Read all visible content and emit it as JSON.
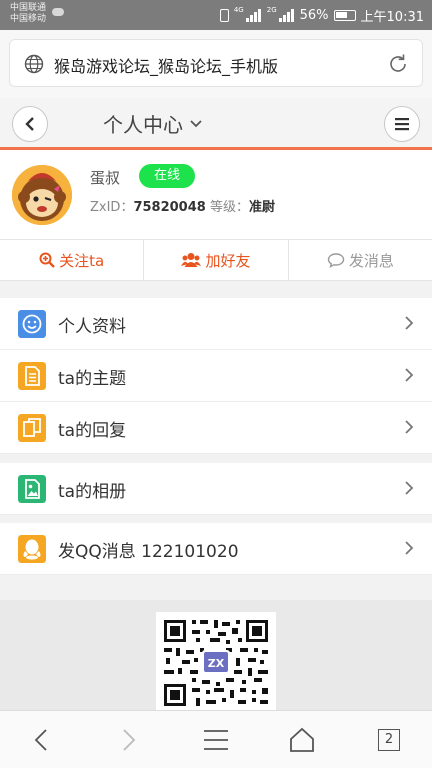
{
  "statusbar": {
    "carrier1": "中国联通",
    "carrier2": "中国移动",
    "network1": "4G",
    "network2": "2G",
    "battery": "56%",
    "time": "上午10:31"
  },
  "browser": {
    "url_title": "猴岛游戏论坛_猴岛论坛_手机版",
    "tab_count": "2"
  },
  "header": {
    "title": "个人中心"
  },
  "profile": {
    "username": "蛋叔",
    "status": "在线",
    "id_label": "ZxID：",
    "id_value": "75820048",
    "level_label": "等级：",
    "level_value": "准尉"
  },
  "actions": [
    {
      "label": "关注ta",
      "icon": "search-plus-icon"
    },
    {
      "label": "加好友",
      "icon": "users-icon"
    },
    {
      "label": "发消息",
      "icon": "comment-icon"
    }
  ],
  "menu": [
    {
      "label": "个人资料",
      "icon": "smile-icon",
      "color": "#4a8ee6"
    },
    {
      "label": "ta的主题",
      "icon": "document-icon",
      "color": "#f5a623"
    },
    {
      "label": "ta的回复",
      "icon": "copy-icon",
      "color": "#f5a623"
    },
    {
      "label": "ta的相册",
      "icon": "image-icon",
      "color": "#2bb673"
    },
    {
      "label": "发QQ消息 122101020",
      "icon": "qq-icon",
      "color": "#f5a623"
    }
  ],
  "colors": {
    "accent": "#f0744c",
    "online": "#1de24c",
    "action_orange": "#e8541e"
  }
}
